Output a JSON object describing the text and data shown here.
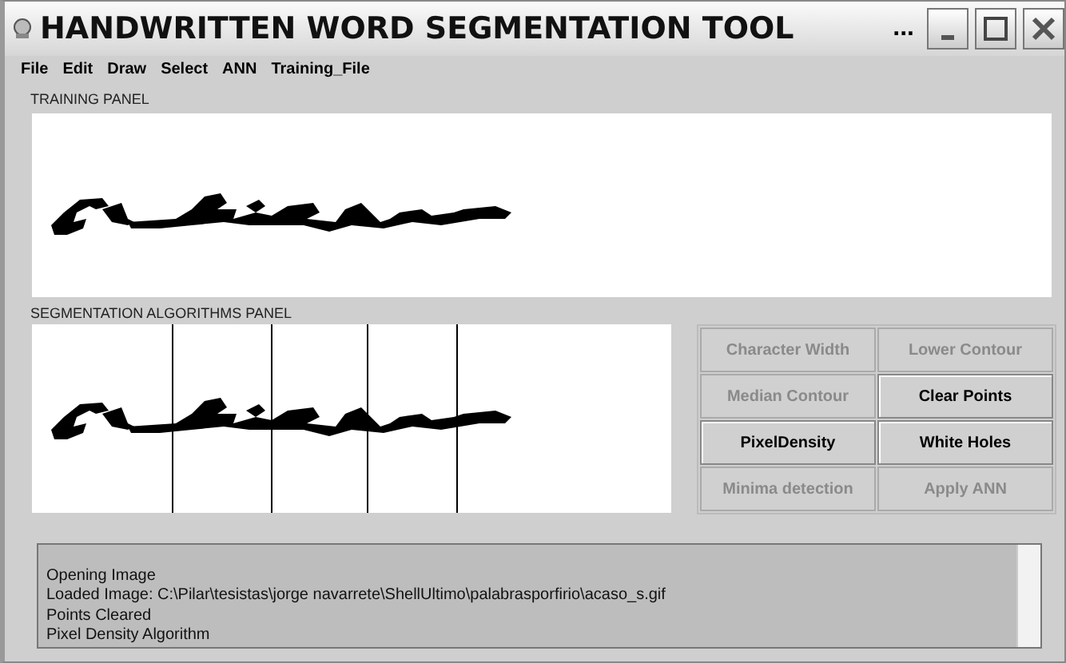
{
  "window": {
    "title": "HANDWRITTEN WORD SEGMENTATION TOOL",
    "overflow": "..."
  },
  "menu": [
    "File",
    "Edit",
    "Draw",
    "Select",
    "ANN",
    "Training_File"
  ],
  "training_panel": {
    "label": "TRAINING PANEL"
  },
  "segmentation_panel": {
    "label": "SEGMENTATION ALGORITHMS PANEL"
  },
  "buttons": [
    {
      "label": "Character Width",
      "disabled": true
    },
    {
      "label": "Lower Contour",
      "disabled": true
    },
    {
      "label": "Median Contour",
      "disabled": true
    },
    {
      "label": "Clear Points",
      "disabled": false
    },
    {
      "label": "PixelDensity",
      "disabled": false
    },
    {
      "label": "White Holes",
      "disabled": false
    },
    {
      "label": "Minima detection",
      "disabled": true
    },
    {
      "label": "Apply ANN",
      "disabled": true
    }
  ],
  "log": [
    "Opening Image",
    "Loaded Image: C:\\Pilar\\tesistas\\jorge navarrete\\ShellUltimo\\palabrasporfirio\\acaso_s.gif",
    "Points Cleared",
    "Pixel Density Algorithm"
  ]
}
